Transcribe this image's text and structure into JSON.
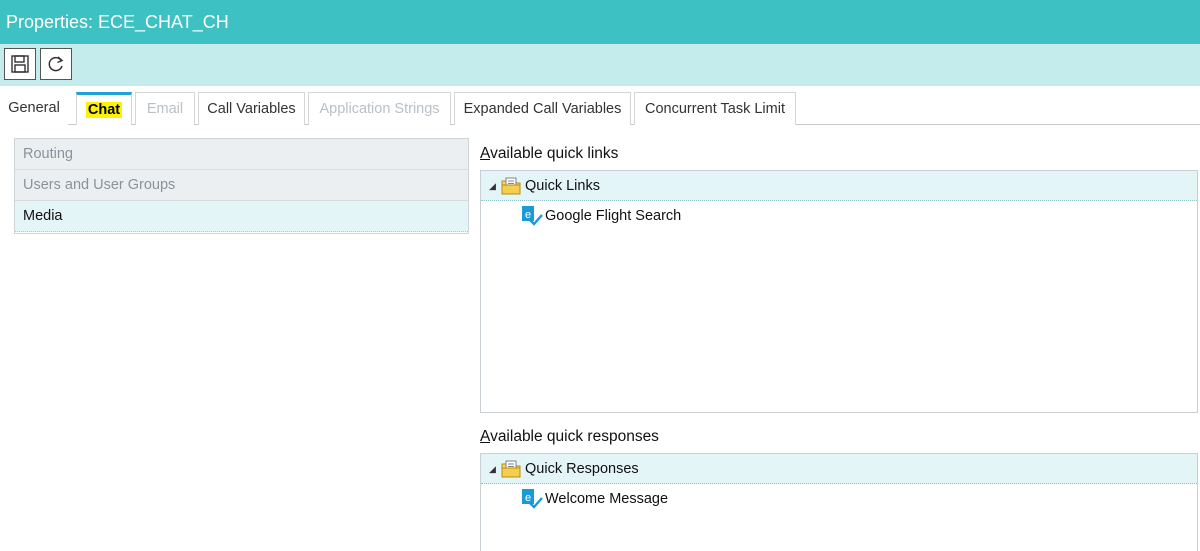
{
  "window": {
    "title": "Properties: ECE_CHAT_CH"
  },
  "toolbar": {
    "buttons": [
      {
        "name": "save",
        "icon": "save-icon"
      },
      {
        "name": "refresh",
        "icon": "refresh-icon"
      }
    ]
  },
  "tabs": [
    {
      "label": "General",
      "state": "normal"
    },
    {
      "label": "Chat",
      "state": "active"
    },
    {
      "label": "Email",
      "state": "disabled"
    },
    {
      "label": "Call Variables",
      "state": "normal"
    },
    {
      "label": "Application Strings",
      "state": "disabled"
    },
    {
      "label": "Expanded Call Variables",
      "state": "normal"
    },
    {
      "label": "Concurrent Task Limit",
      "state": "normal"
    }
  ],
  "nav": {
    "items": [
      {
        "label": "Routing",
        "selected": false
      },
      {
        "label": "Users and User Groups",
        "selected": false
      },
      {
        "label": "Media",
        "selected": true
      }
    ]
  },
  "quick_links": {
    "heading_access_key": "A",
    "heading_rest": "vailable quick links",
    "root_label": "Quick Links",
    "items": [
      {
        "label": "Google Flight Search"
      }
    ]
  },
  "quick_responses": {
    "heading_access_key": "A",
    "heading_rest": "vailable quick responses",
    "root_label": "Quick Responses",
    "items": [
      {
        "label": "Welcome Message"
      }
    ]
  },
  "colors": {
    "title_bar": "#3dc1c3",
    "toolbar": "#c4ecec",
    "active_tab_accent": "#1ea3d7",
    "highlight": "#fff200",
    "selected_row": "#e3f5f6"
  }
}
